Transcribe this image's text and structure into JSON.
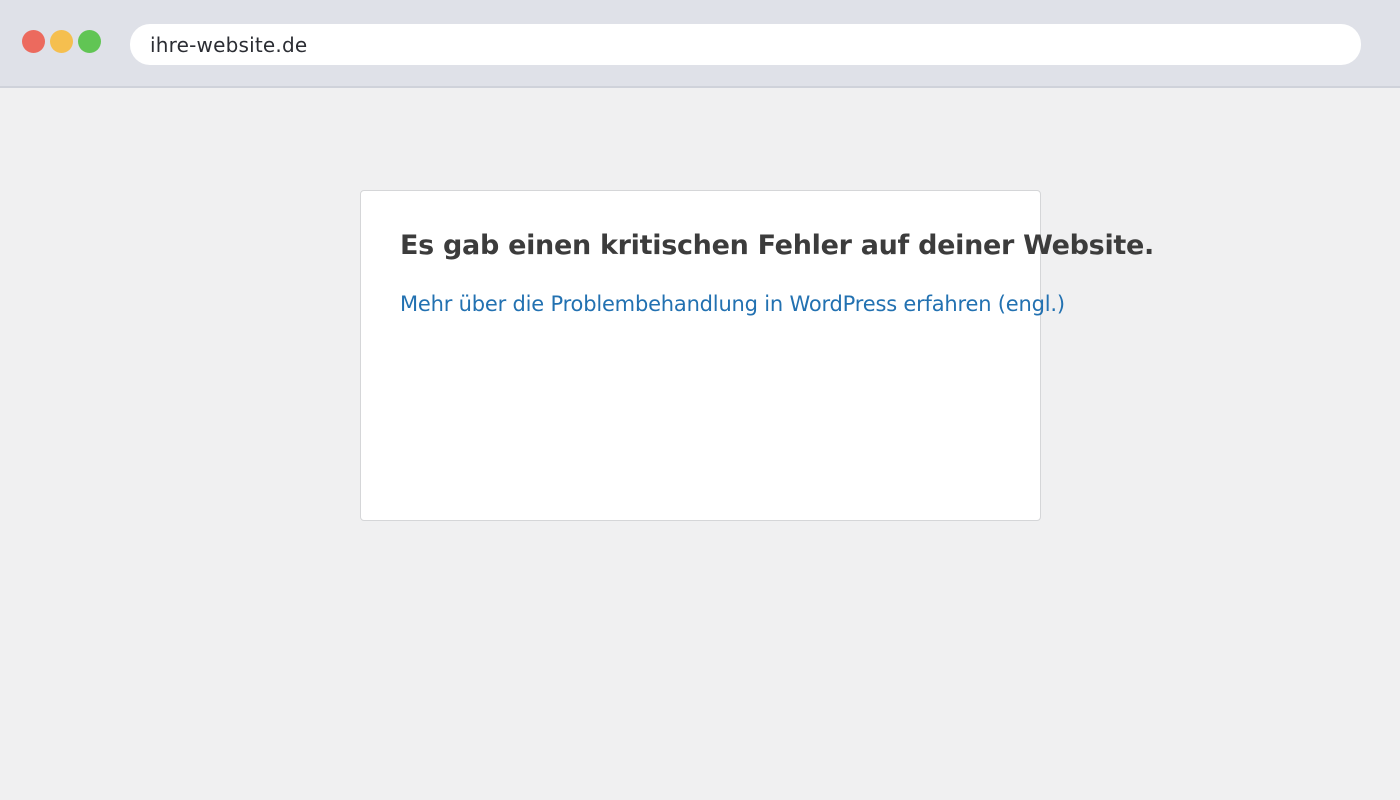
{
  "browser": {
    "url": "ihre-website.de",
    "window_controls": [
      {
        "name": "close",
        "color": "#ec6a5e"
      },
      {
        "name": "minimize",
        "color": "#f5bf4f"
      },
      {
        "name": "maximize",
        "color": "#61c554"
      }
    ]
  },
  "page": {
    "error_title": "Es gab einen kritischen Fehler auf deiner Website.",
    "help_link": "Mehr über die Problembehandlung in WordPress erfahren (engl.)"
  },
  "colors": {
    "link": "#2271b1",
    "title": "#3c3c3c",
    "background": "#f0f0f1"
  }
}
